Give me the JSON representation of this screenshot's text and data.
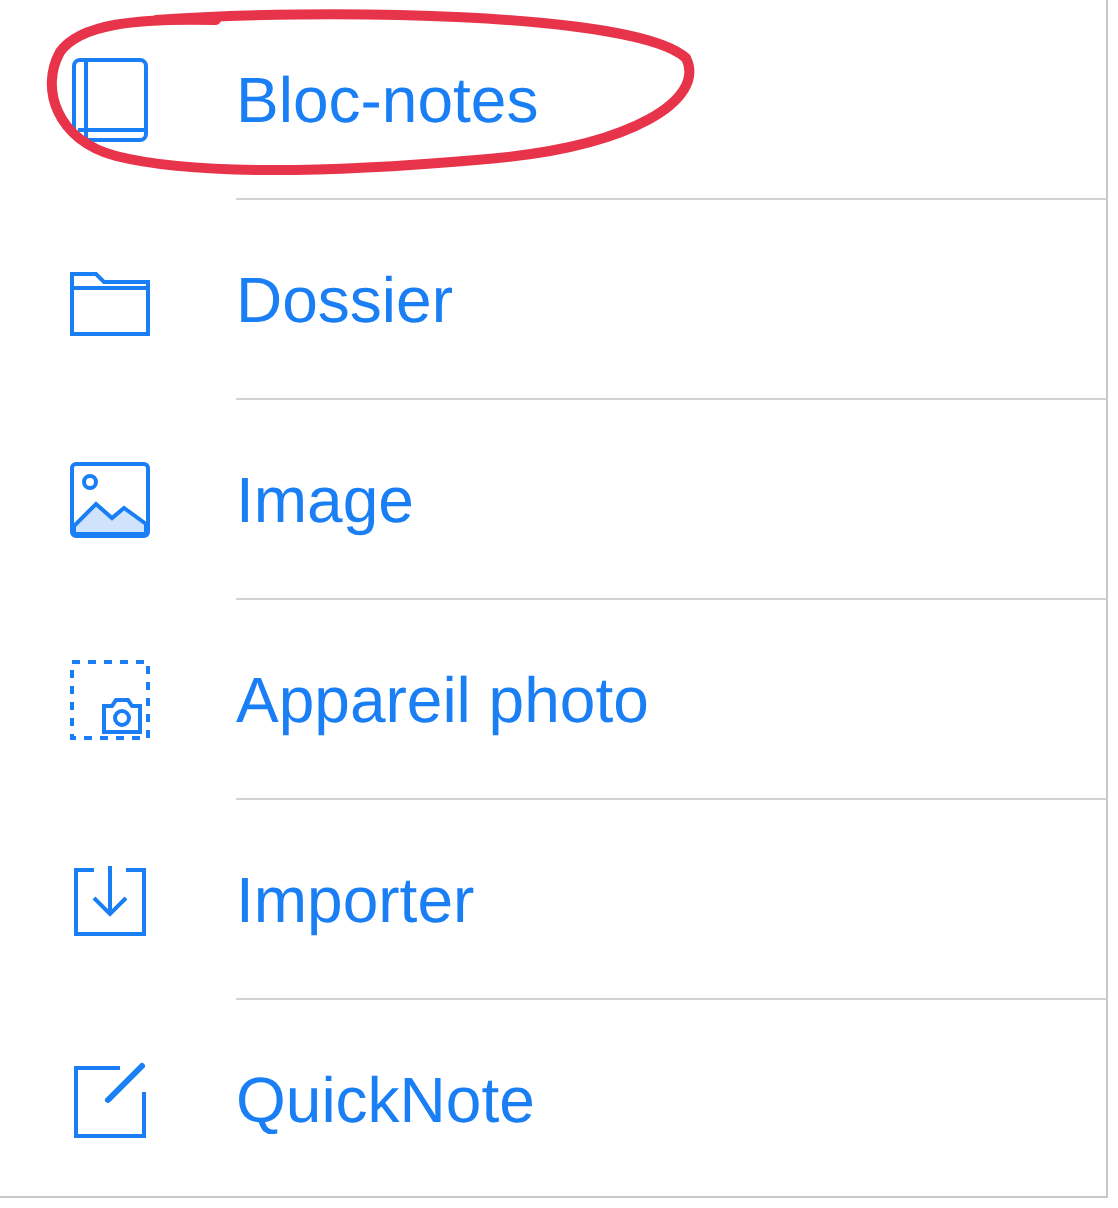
{
  "menu": {
    "items": [
      {
        "label": "Bloc-notes",
        "kind": "notebook",
        "circled": true
      },
      {
        "label": "Dossier",
        "kind": "folder",
        "circled": false
      },
      {
        "label": "Image",
        "kind": "image",
        "circled": false
      },
      {
        "label": "Appareil photo",
        "kind": "camera",
        "circled": false
      },
      {
        "label": "Importer",
        "kind": "import",
        "circled": false
      },
      {
        "label": "QuickNote",
        "kind": "quicknote",
        "circled": false
      }
    ]
  }
}
